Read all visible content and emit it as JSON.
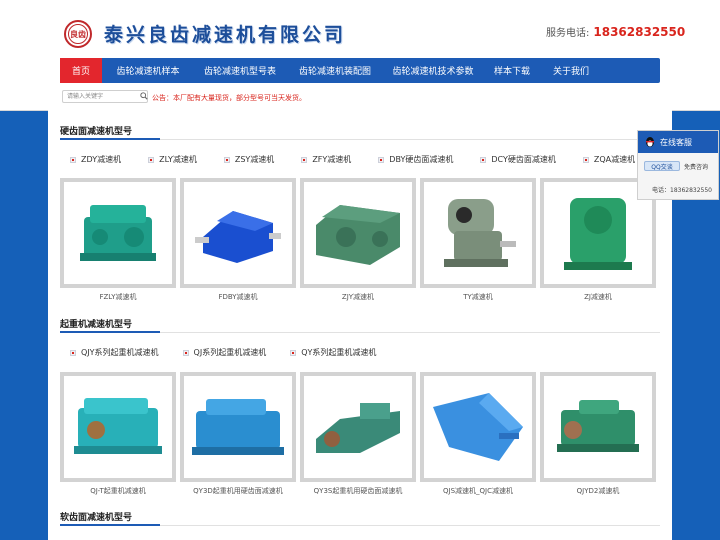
{
  "header": {
    "logo_text": "良齿",
    "company": "泰兴良齿减速机有限公司",
    "phone_label": "服务电话:",
    "phone": "18362832550"
  },
  "nav": {
    "items": [
      "首页",
      "齿轮减速机样本",
      "齿轮减速机型号表",
      "齿轮减速机装配图",
      "齿轮减速机技术参数",
      "样本下载",
      "关于我们"
    ]
  },
  "search": {
    "placeholder": "请输入关键字",
    "icon": "search-icon"
  },
  "notice": "公告：本厂配有大量现货，部分型号可当天发货。",
  "sections": [
    {
      "title": "硬齿面减速机型号",
      "categories": [
        "ZDY减速机",
        "ZLY减速机",
        "ZSY减速机",
        "ZFY减速机",
        "DBY硬齿面减速机",
        "DCY硬齿面减速机",
        "ZQA减速机"
      ],
      "products": [
        {
          "name": "FZLY减速机",
          "color": "#1f9e8a"
        },
        {
          "name": "FDBY减速机",
          "color": "#1a4fd0"
        },
        {
          "name": "ZJY减速机",
          "color": "#4a8a6a"
        },
        {
          "name": "TY减速机",
          "color": "#8a9e8a"
        },
        {
          "name": "ZJ减速机",
          "color": "#2aa06a"
        }
      ]
    },
    {
      "title": "起重机减速机型号",
      "categories": [
        "QJY系列起重机减速机",
        "QJ系列起重机减速机",
        "QY系列起重机减速机"
      ],
      "products": [
        {
          "name": "QJ-T起重机减速机",
          "color": "#28b0b8"
        },
        {
          "name": "QY3D起重机用硬齿面减速机",
          "color": "#2a8ed0"
        },
        {
          "name": "QY3S起重机用硬齿面减速机",
          "color": "#3a8a78"
        },
        {
          "name": "QJS减速机_QJC减速机",
          "color": "#3a90e0"
        },
        {
          "name": "QJYD2减速机",
          "color": "#2f8f6a"
        }
      ]
    },
    {
      "title": "软齿面减速机型号"
    }
  ],
  "customer_service": {
    "title": "在线客服",
    "qq_label": "QQ交谈",
    "free_label": "免费咨询",
    "tel": "电话：18362832550"
  },
  "colors": {
    "brand_blue": "#1d5bb5",
    "accent_red": "#e3262d"
  }
}
